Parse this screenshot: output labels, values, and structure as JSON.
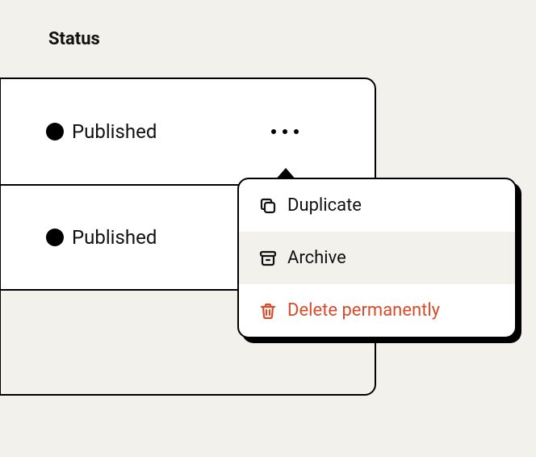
{
  "column_header": "Status",
  "rows": [
    {
      "status_label": "Published"
    },
    {
      "status_label": "Published"
    }
  ],
  "menu": {
    "duplicate_label": "Duplicate",
    "archive_label": "Archive",
    "delete_label": "Delete permanently"
  },
  "colors": {
    "danger": "#d84c2a",
    "highlight_bg": "#f3f1eb"
  }
}
